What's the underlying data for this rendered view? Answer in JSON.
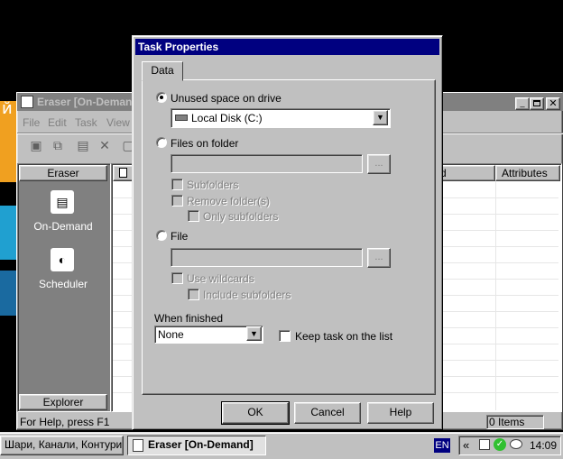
{
  "main_window": {
    "title": "Eraser  [On-Demand]",
    "menu": [
      "File",
      "Edit",
      "Task",
      "View"
    ],
    "left_pane": {
      "header": "Eraser",
      "items": [
        {
          "label": "On-Demand",
          "icon": "on-demand-icon"
        },
        {
          "label": "Scheduler",
          "icon": "scheduler-icon"
        }
      ],
      "footer": "Explorer"
    },
    "list": {
      "columns": [
        "",
        "d",
        "Attributes"
      ]
    },
    "status": {
      "help": "For Help, press F1",
      "items": "0 Items"
    }
  },
  "dialog": {
    "title": "Task Properties",
    "tab": "Data",
    "unused_space": {
      "label": "Unused space on drive",
      "selected": true,
      "drive": "Local Disk (C:)"
    },
    "files_on_folder": {
      "label": "Files on folder",
      "selected": false,
      "path": "",
      "browse": "...",
      "subfolders": "Subfolders",
      "remove_folders": "Remove folder(s)",
      "only_subfolders": "Only subfolders"
    },
    "file": {
      "label": "File",
      "selected": false,
      "path": "",
      "browse": "...",
      "use_wildcards": "Use wildcards",
      "include_subfolders": "Include subfolders"
    },
    "when_finished": {
      "label": "When finished",
      "value": "None"
    },
    "keep_task": "Keep task on the list",
    "buttons": {
      "ok": "OK",
      "cancel": "Cancel",
      "help": "Help"
    }
  },
  "taskbar": {
    "buttons": [
      "Шари, Канали, Контури, ...",
      "Eraser  [On-Demand]"
    ],
    "language": "EN",
    "tray_arrow": "«",
    "time": "14:09"
  },
  "colors": {
    "title_active": "#000080",
    "face": "#c0c0c0",
    "desktop": "#000000"
  }
}
